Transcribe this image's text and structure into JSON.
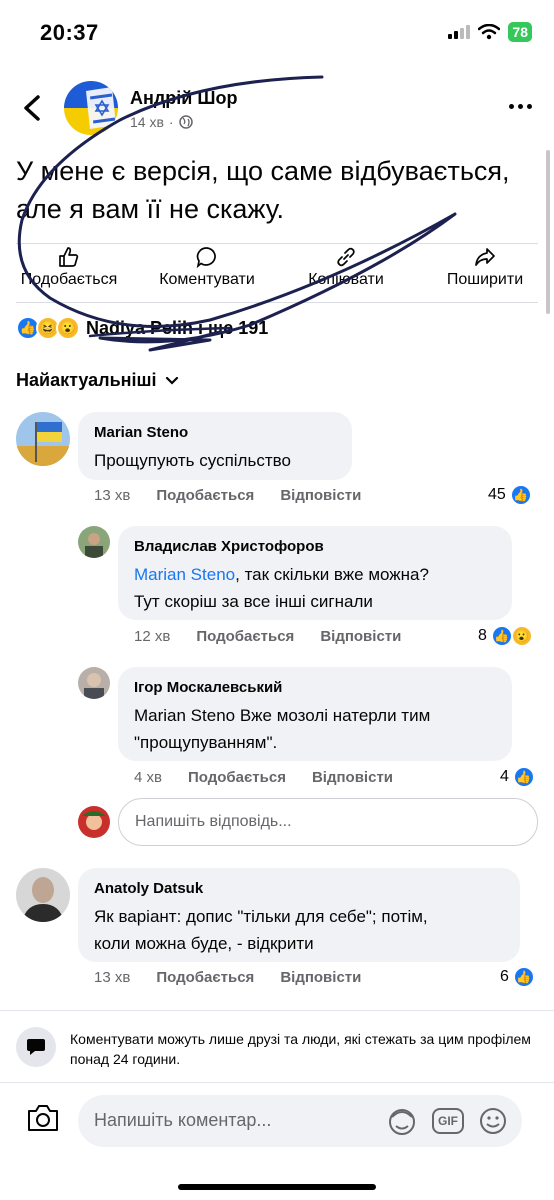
{
  "status": {
    "time": "20:37",
    "battery": "78"
  },
  "post": {
    "author": "Андрій Шор",
    "time": "14 хв",
    "separator": "·",
    "text": "У мене є версія, що саме відбувається, але я вам її не скажу."
  },
  "actions": [
    {
      "label": "Подобається",
      "icon": "thumbs-up-icon"
    },
    {
      "label": "Коментувати",
      "icon": "comment-icon"
    },
    {
      "label": "Копіювати",
      "icon": "copy-icon"
    },
    {
      "label": "Поширити",
      "icon": "share-icon"
    }
  ],
  "reactions": {
    "summary": "Nadiya Pelih і ще 191"
  },
  "sort": {
    "label": "Найактуальніші"
  },
  "comments": [
    {
      "name": "Marian Steno",
      "text": "Прощупують суспільство",
      "time": "13 хв",
      "like": "Подобається",
      "reply": "Відповісти",
      "count": "45"
    },
    {
      "name": "Владислав Христофоров",
      "mention": "Marian Steno",
      "text1_rest": ", так скільки вже можна?",
      "text2": "Тут скоріш за все інші сигнали",
      "time": "12 хв",
      "like": "Подобається",
      "reply": "Відповісти",
      "count": "8"
    },
    {
      "name": "Ігор Москалевський",
      "text1": "Marian Steno Вже мозолі натерли тим",
      "text2": "\"прощупуванням\".",
      "time": "4 хв",
      "like": "Подобається",
      "reply": "Відповісти",
      "count": "4"
    },
    {
      "name": "Anatoly Datsuk",
      "text1": "Як варіант: допис \"тільки для себе\"; потім,",
      "text2": "коли можна буде, - відкрити",
      "time": "13 хв",
      "like": "Подобається",
      "reply": "Відповісти",
      "count": "6"
    }
  ],
  "reply_input": {
    "placeholder": "Напишіть відповідь..."
  },
  "notice": {
    "text": "Коментувати можуть лише друзі та люди, які стежать за цим профілем понад 24 години."
  },
  "composer": {
    "placeholder": "Напишіть коментар...",
    "gif": "GIF"
  },
  "colors": {
    "accent": "#1877f2",
    "bubble": "#f0f2f5",
    "muted": "#65676b"
  }
}
